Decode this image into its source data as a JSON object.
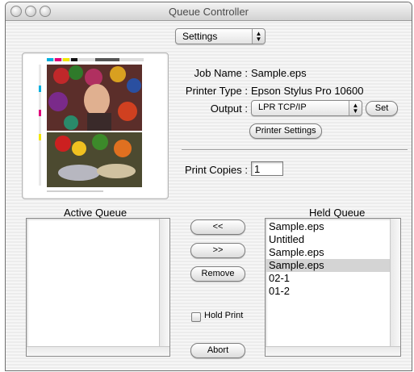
{
  "window": {
    "title": "Queue Controller"
  },
  "settings_popup": {
    "value": "Settings"
  },
  "job": {
    "job_name_label": "Job Name :",
    "job_name_value": "Sample.eps",
    "printer_type_label": "Printer Type :",
    "printer_type_value": "Epson Stylus Pro 10600",
    "output_label": "Output :",
    "output_value": "LPR TCP/IP",
    "set_button": "Set",
    "printer_settings_button": "Printer Settings",
    "print_copies_label": "Print Copies :",
    "print_copies_value": "1"
  },
  "active_queue": {
    "title": "Active Queue",
    "items": []
  },
  "held_queue": {
    "title": "Held Queue",
    "items": [
      {
        "label": "Sample.eps"
      },
      {
        "label": "Untitled"
      },
      {
        "label": "Sample.eps"
      },
      {
        "label": "Sample.eps",
        "selected": true
      },
      {
        "label": "02-1"
      },
      {
        "label": "01-2"
      }
    ]
  },
  "controls": {
    "move_left_button": "<<",
    "move_right_button": ">>",
    "remove_button": "Remove",
    "hold_print_label": "Hold Print",
    "abort_button": "Abort"
  },
  "colors": {
    "selection": "#d4d4d4"
  }
}
